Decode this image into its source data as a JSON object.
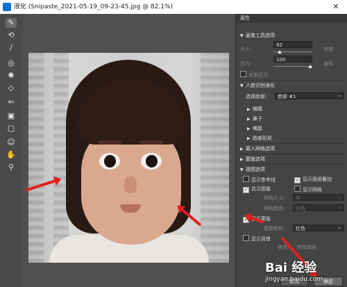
{
  "window": {
    "title": "液化 (Snipaste_2021-05-19_09-23-45.jpg @ 82.1%)",
    "close_glyph": "✕"
  },
  "tools": [
    "brush-icon",
    "reconstruct-icon",
    "smooth-icon",
    "twirl-icon",
    "pucker-icon",
    "bloat-icon",
    "push-left-icon",
    "freeze-mask-icon",
    "thaw-mask-icon",
    "face-tool-icon",
    "hand-icon",
    "zoom-icon"
  ],
  "panel": {
    "header": "属性",
    "brush_section": "画笔工具选项",
    "size_label": "大小:",
    "size_value": "92",
    "density_label": "浓度:",
    "pressure_label": "压力:",
    "pressure_value": "100",
    "rate_label": "速率:",
    "stylus_label": "光笔压力",
    "face_section": "人脸识别液化",
    "select_face_label": "选择脸部:",
    "select_face_value": "脸部 #1",
    "eyes": "眼睛",
    "nose": "鼻子",
    "mouth": "嘴唇",
    "face_shape": "脸部形状",
    "load_mesh_section": "载入网格选项",
    "mask_section": "蒙版选项",
    "view_section": "视图选项",
    "show_guides": "显示参考线",
    "show_face_overlay": "显示面部叠加",
    "show_image": "显示图像",
    "show_mesh": "显示网格",
    "mesh_size_label": "网格大小:",
    "mesh_size_value": "中",
    "mesh_color_label": "网格颜色:",
    "mesh_color_value": "灰色",
    "show_mask": "显示蒙版",
    "mask_color_label": "蒙版颜色:",
    "mask_color_value": "红色",
    "show_backdrop": "显示背景",
    "use_label": "使用:",
    "use_value": "所有图层",
    "cancel_label": "取消",
    "ok_label": "确定"
  },
  "watermark": {
    "logo_text": "Bai 经验",
    "url": "jingyan.baidu.com"
  },
  "colors": {
    "arrow": "#e0201e",
    "panel_bg": "#444444",
    "canvas_bg": "#505050"
  }
}
